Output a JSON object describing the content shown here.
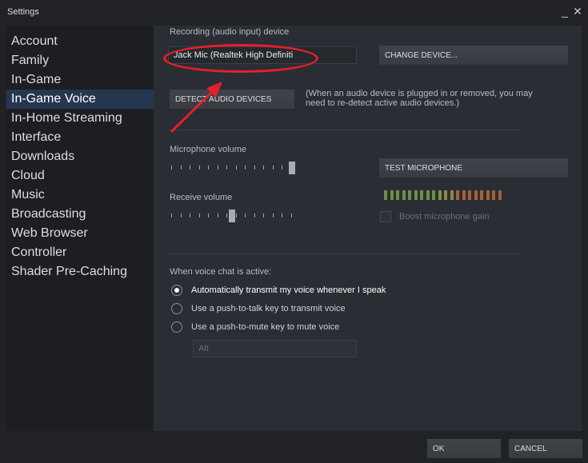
{
  "window": {
    "title": "Settings",
    "minimize_symbol": "_",
    "close_symbol": "✕"
  },
  "sidebar": {
    "items": [
      {
        "label": "Account"
      },
      {
        "label": "Family"
      },
      {
        "label": "In-Game"
      },
      {
        "label": "In-Game Voice",
        "active": true
      },
      {
        "label": "In-Home Streaming"
      },
      {
        "label": "Interface"
      },
      {
        "label": "Downloads"
      },
      {
        "label": "Cloud"
      },
      {
        "label": "Music"
      },
      {
        "label": "Broadcasting"
      },
      {
        "label": "Web Browser"
      },
      {
        "label": "Controller"
      },
      {
        "label": "Shader Pre-Caching"
      }
    ]
  },
  "voice": {
    "device_label": "Recording (audio input) device",
    "device_value": "Jack Mic (Realtek High Definiti",
    "change_device_label": "CHANGE DEVICE...",
    "detect_devices_label": "DETECT AUDIO DEVICES",
    "detect_note": "(When an audio device is plugged in or removed, you may need to re-detect active audio devices.)",
    "mic_volume_label": "Microphone volume",
    "mic_volume_level": 1.0,
    "test_mic_label": "TEST MICROPHONE",
    "receive_volume_label": "Receive volume",
    "receive_volume_level": 0.5,
    "boost_label": "Boost microphone gain",
    "boost_checked": false,
    "active_label": "When voice chat is active:",
    "options": [
      {
        "label": "Automatically transmit my voice whenever I speak",
        "selected": true
      },
      {
        "label": "Use a push-to-talk key to transmit voice",
        "selected": false
      },
      {
        "label": "Use a push-to-mute key to mute voice",
        "selected": false
      }
    ],
    "key_value": "Alt"
  },
  "meter_colors": {
    "green": "#6b8f43",
    "olive": "#8c8a45",
    "orange": "#a5613a"
  },
  "annotation_color": "#e5202a",
  "footer": {
    "ok_label": "OK",
    "cancel_label": "CANCEL"
  }
}
